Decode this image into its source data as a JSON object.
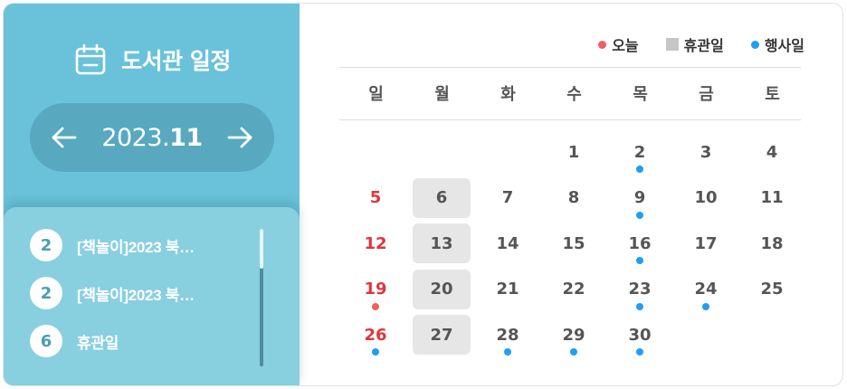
{
  "title": "도서관 일정",
  "month_nav": {
    "year": "2023.",
    "month": "11"
  },
  "events": [
    {
      "day": "2",
      "text": "[책놀이]2023 북…"
    },
    {
      "day": "2",
      "text": "[책놀이]2023 북…"
    },
    {
      "day": "6",
      "text": "휴관일"
    }
  ],
  "scroll_position": 0,
  "legend": {
    "today": "오늘",
    "holiday": "휴관일",
    "event": "행사일"
  },
  "colors": {
    "left_bg": "#69c2d9",
    "today": "#f06060",
    "event": "#1e9ff2",
    "sunday": "#e0353a",
    "holiday_bg": "#e6e6e6"
  },
  "weekdays": [
    "일",
    "월",
    "화",
    "수",
    "목",
    "금",
    "토"
  ],
  "calendar": {
    "weeks": [
      [
        null,
        null,
        null,
        "1",
        "2",
        "3",
        "4"
      ],
      [
        "5",
        "6",
        "7",
        "8",
        "9",
        "10",
        "11"
      ],
      [
        "12",
        "13",
        "14",
        "15",
        "16",
        "17",
        "18"
      ],
      [
        "19",
        "20",
        "21",
        "22",
        "23",
        "24",
        "25"
      ],
      [
        "26",
        "27",
        "28",
        "29",
        "30",
        null,
        null
      ]
    ],
    "holidays": [
      "6",
      "13",
      "20",
      "27"
    ],
    "event_days": [
      "2",
      "9",
      "16",
      "23",
      "24",
      "26",
      "28",
      "29",
      "30"
    ],
    "today": "19"
  }
}
